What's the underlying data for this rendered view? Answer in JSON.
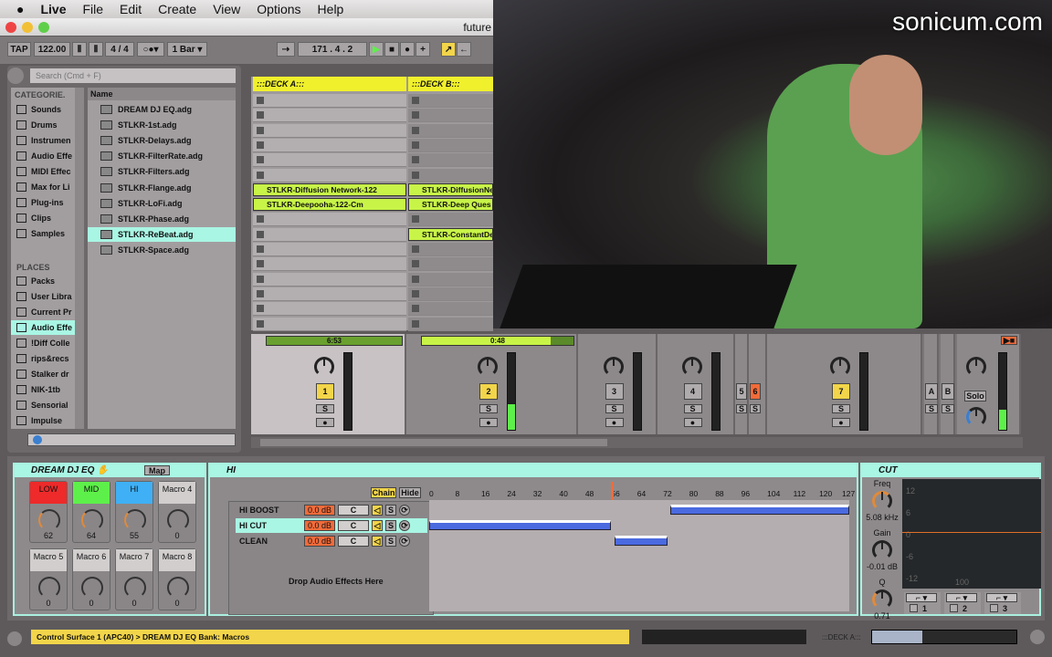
{
  "menubar": {
    "app": "Live",
    "items": [
      "File",
      "Edit",
      "Create",
      "View",
      "Options",
      "Help"
    ]
  },
  "window": {
    "title": "future"
  },
  "transport": {
    "tap": "TAP",
    "tempo": "122.00",
    "sig": "4 / 4",
    "quant": "1 Bar",
    "position": "171 .  4 .  2"
  },
  "browser": {
    "search_placeholder": "Search (Cmd + F)",
    "categories_header": "CATEGORIE.",
    "name_header": "Name",
    "categories": [
      "Sounds",
      "Drums",
      "Instrumen",
      "Audio Effe",
      "MIDI Effec",
      "Max for Li",
      "Plug-ins",
      "Clips",
      "Samples"
    ],
    "places_header": "PLACES",
    "places": [
      "Packs",
      "User Libra",
      "Current Pr",
      "Audio Effe",
      "!Diff Colle",
      "rips&recs",
      "Stalker dr",
      "NIK-1tb",
      "Sensorial",
      "Impulse"
    ],
    "files": [
      "DREAM DJ EQ.adg",
      "STLKR-1st.adg",
      "STLKR-Delays.adg",
      "STLKR-FilterRate.adg",
      "STLKR-Filters.adg",
      "STLKR-Flange.adg",
      "STLKR-LoFi.adg",
      "STLKR-Phase.adg",
      "STLKR-ReBeat.adg",
      "STLKR-Space.adg"
    ],
    "selected_file": 8,
    "selected_place": 3
  },
  "session": {
    "decks": [
      {
        "name": ":::DECK A:::",
        "clips": {
          "6": "STLKR-Diffusion Network-122",
          "7": "STLKR-Deepooha-122-Cm"
        },
        "time": "6:53",
        "progress": 1.0
      },
      {
        "name": ":::DECK B:::",
        "clips": {
          "6": "STLKR-DiffusionNe",
          "7": "STLKR-Deep Ques",
          "9": "STLKR-ConstantDe"
        },
        "time": "0:48",
        "progress": 0.85
      }
    ]
  },
  "mixer": {
    "tracks": [
      "1",
      "2",
      "3",
      "4",
      "5",
      "6",
      "7"
    ],
    "solo": "S",
    "returns": [
      "A",
      "B"
    ],
    "master_solo": "Solo"
  },
  "rack": {
    "title": "DREAM DJ EQ",
    "map": "Map",
    "macros": [
      {
        "label": "LOW",
        "value": "62",
        "color": "#ee2a2a"
      },
      {
        "label": "MID",
        "value": "64",
        "color": "#5ef04a"
      },
      {
        "label": "HI",
        "value": "55",
        "color": "#3fb0f5"
      },
      {
        "label": "Macro 4",
        "value": "0"
      },
      {
        "label": "Macro 5",
        "value": "0"
      },
      {
        "label": "Macro 6",
        "value": "0"
      },
      {
        "label": "Macro 7",
        "value": "0"
      },
      {
        "label": "Macro 8",
        "value": "0"
      }
    ]
  },
  "chain": {
    "title": "HI",
    "chain_btn": "Chain",
    "hide_btn": "Hide",
    "drop_text": "Drop Audio Effects Here",
    "rows": [
      {
        "name": "HI BOOST",
        "db": "0.0 dB",
        "pan": "C",
        "zone": [
          73,
          127
        ]
      },
      {
        "name": "HI CUT",
        "db": "0.0 dB",
        "pan": "C",
        "zone": [
          0,
          55
        ]
      },
      {
        "name": "CLEAN",
        "db": "0.0 dB",
        "pan": "C",
        "zone": [
          56,
          72
        ]
      }
    ],
    "ruler": [
      "0",
      "8",
      "16",
      "24",
      "32",
      "40",
      "48",
      "56",
      "64",
      "72",
      "80",
      "88",
      "96",
      "104",
      "112",
      "120",
      "127"
    ],
    "fade_value": 55
  },
  "eq": {
    "title": "CUT",
    "freq_label": "Freq",
    "freq": "5.08 kHz",
    "gain_label": "Gain",
    "gain": "-0.01 dB",
    "q_label": "Q",
    "q": "0.71",
    "db_ticks": [
      "12",
      "6",
      "0",
      "-6",
      "-12"
    ],
    "hz_tick": "100",
    "bands": [
      "1",
      "2",
      "3"
    ]
  },
  "status": {
    "text": "Control Surface 1 (APC40) > DREAM DJ EQ Bank: Macros",
    "deck": ":::DECK A:::"
  },
  "webcam": {
    "watermark": "sonicum.com"
  }
}
